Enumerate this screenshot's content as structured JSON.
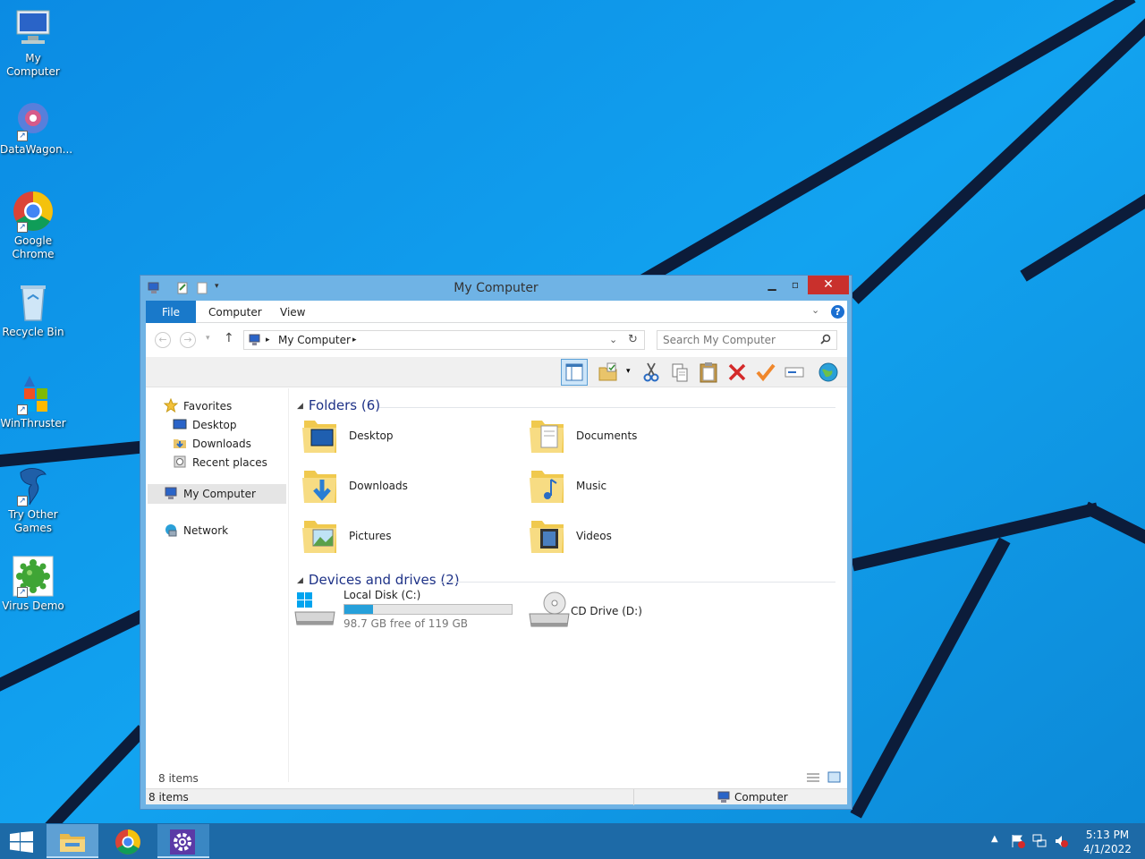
{
  "desktop": {
    "icons": [
      {
        "label": "My Computer",
        "icon": "computer-icon"
      },
      {
        "label": "DataWagon...",
        "icon": "datawagon-icon"
      },
      {
        "label": "Google Chrome",
        "icon": "chrome-icon"
      },
      {
        "label": "Recycle Bin",
        "icon": "recycle-bin-icon"
      },
      {
        "label": "WinThruster",
        "icon": "winthruster-icon"
      },
      {
        "label": "Try Other Games",
        "icon": "games-icon"
      },
      {
        "label": "Virus Demo",
        "icon": "virus-icon"
      }
    ]
  },
  "window": {
    "title": "My Computer",
    "ribbon_tabs": [
      "File",
      "Computer",
      "View"
    ],
    "help": "?",
    "address_crumb": "My Computer",
    "search_placeholder": "Search My Computer",
    "nav": {
      "favorites": "Favorites",
      "items": [
        "Desktop",
        "Downloads",
        "Recent places"
      ],
      "computer": "My Computer",
      "network": "Network"
    },
    "groups": {
      "folders": "Folders (6)",
      "devices": "Devices and drives (2)"
    },
    "folders": [
      "Desktop",
      "Documents",
      "Downloads",
      "Music",
      "Pictures",
      "Videos"
    ],
    "drives": {
      "c_label": "Local Disk (C:)",
      "c_free": "98.7 GB free of 119 GB",
      "c_used_fraction": 0.17,
      "d_label": "CD Drive (D:)"
    },
    "item_count": "8 items",
    "status_left": "8 items",
    "status_right": "Computer"
  },
  "taskbar": {
    "time": "5:13 PM",
    "date": "4/1/2022"
  },
  "colors": {
    "accent": "#1979ca",
    "close": "#c9302c",
    "drive_fill": "#26a0da"
  }
}
